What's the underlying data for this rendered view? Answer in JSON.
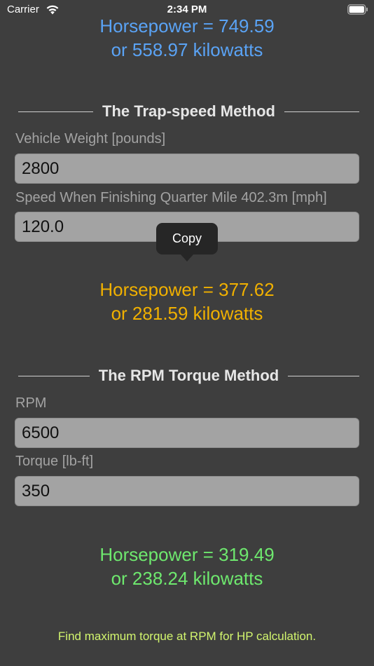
{
  "status_bar": {
    "carrier": "Carrier",
    "time": "2:34 PM"
  },
  "results": {
    "top": {
      "horsepower": "Horsepower = 749.59",
      "kilowatts": "or 558.97 kilowatts",
      "color": "#5aa3f5"
    },
    "trap_speed": {
      "horsepower": "Horsepower = 377.62",
      "kilowatts": "or 281.59 kilowatts",
      "color": "#f0b000"
    },
    "rpm_torque": {
      "horsepower": "Horsepower = 319.49",
      "kilowatts": "or 238.24 kilowatts",
      "color": "#6ee86e"
    }
  },
  "trap_speed": {
    "title": "The Trap-speed Method",
    "weight_label": "Vehicle Weight [pounds]",
    "weight_value": "2800",
    "speed_label": "Speed When Finishing Quarter Mile 402.3m [mph]",
    "speed_value": "120.0"
  },
  "copy_menu": {
    "label": "Copy"
  },
  "rpm_torque": {
    "title": "The RPM Torque Method",
    "rpm_label": "RPM",
    "rpm_value": "6500",
    "torque_label": "Torque [lb-ft]",
    "torque_value": "350"
  },
  "footer": {
    "link_text": "Find maximum torque at RPM for HP calculation.",
    "color": "#d2f56e"
  },
  "colors": {
    "background": "#3e3e3e",
    "input_background": "#a3a3a3",
    "label": "#a3a3a3"
  }
}
